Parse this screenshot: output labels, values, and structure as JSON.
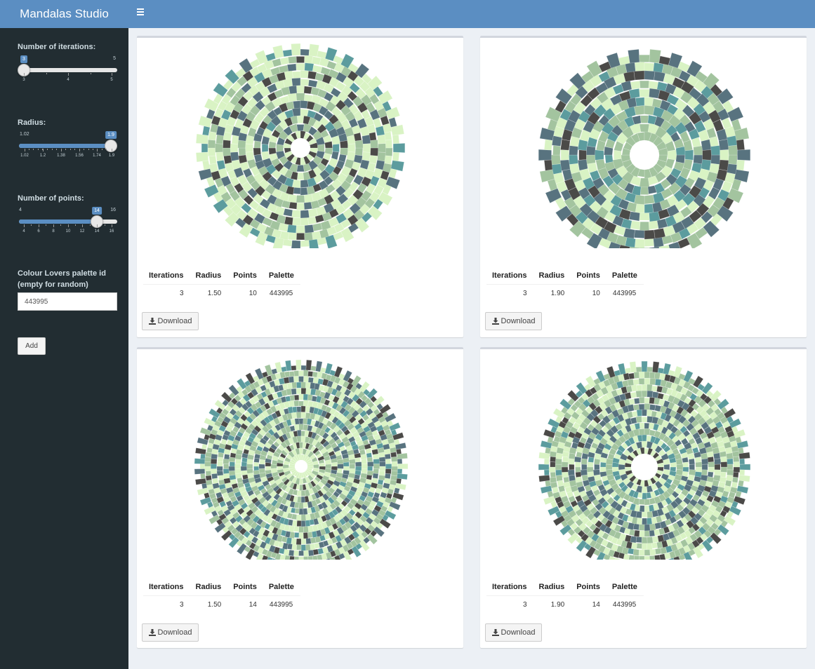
{
  "app": {
    "title": "Mandalas Studio"
  },
  "sidebar": {
    "iterations": {
      "label": "Number of iterations:",
      "min": "3",
      "max": "5",
      "value": "3",
      "ticks": [
        "3",
        "4",
        "5"
      ]
    },
    "radius": {
      "label": "Radius:",
      "min": "1.02",
      "max": "1.9",
      "value": "1.9",
      "ticks": [
        "1.02",
        "1.2",
        "1.38",
        "1.56",
        "1.74",
        "1.9"
      ]
    },
    "points": {
      "label": "Number of points:",
      "min": "4",
      "max": "16",
      "value": "14",
      "ticks": [
        "4",
        "6",
        "8",
        "10",
        "12",
        "14",
        "16"
      ]
    },
    "palette": {
      "label_line1": "Colour Lovers palette id",
      "label_line2": "(empty for random)",
      "value": "443995"
    },
    "add_label": "Add"
  },
  "table_headers": {
    "iterations": "Iterations",
    "radius": "Radius",
    "points": "Points",
    "palette": "Palette"
  },
  "download_label": "Download",
  "mandalas": [
    {
      "iterations": "3",
      "radius": "1.50",
      "points": "10",
      "palette": "443995"
    },
    {
      "iterations": "3",
      "radius": "1.90",
      "points": "10",
      "palette": "443995"
    },
    {
      "iterations": "3",
      "radius": "1.50",
      "points": "14",
      "palette": "443995"
    },
    {
      "iterations": "3",
      "radius": "1.90",
      "points": "14",
      "palette": "443995"
    }
  ],
  "colors": {
    "palette": [
      "#4b4a48",
      "#58737f",
      "#5c9c9e",
      "#a3c49f",
      "#d9f3c4"
    ],
    "sidebar_bg": "#222d32",
    "header_bg": "#5b8ec2",
    "accent": "#5b8ec2"
  }
}
